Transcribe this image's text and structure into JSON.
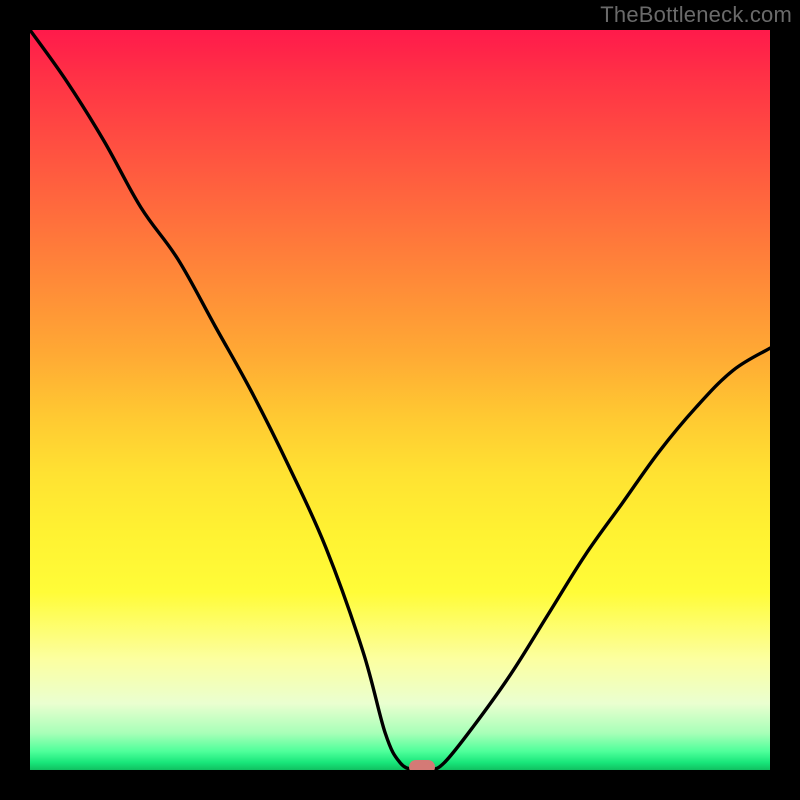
{
  "watermark": "TheBottleneck.com",
  "chart_data": {
    "type": "line",
    "title": "",
    "xlabel": "",
    "ylabel": "",
    "xlim": [
      0,
      100
    ],
    "ylim": [
      0,
      100
    ],
    "grid": false,
    "legend": false,
    "x": [
      0,
      5,
      10,
      15,
      20,
      25,
      30,
      35,
      40,
      45,
      48,
      50,
      52,
      54,
      56,
      60,
      65,
      70,
      75,
      80,
      85,
      90,
      95,
      100
    ],
    "y": [
      100,
      93,
      85,
      76,
      69,
      60,
      51,
      41,
      30,
      16,
      5,
      1,
      0,
      0,
      1,
      6,
      13,
      21,
      29,
      36,
      43,
      49,
      54,
      57
    ],
    "marker": {
      "x": 53,
      "y": 0
    },
    "background_gradient": {
      "top_color": "#ff1a4b",
      "mid_color": "#fff232",
      "bottom_color": "#18e67a"
    }
  }
}
